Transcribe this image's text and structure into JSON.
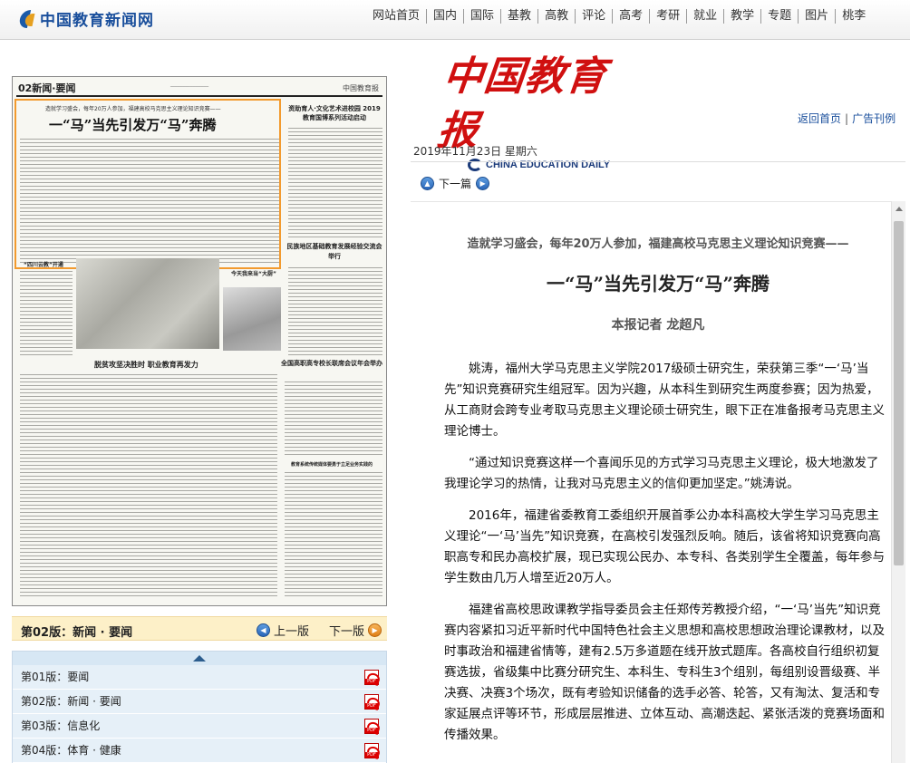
{
  "site": {
    "logo_text": "中国教育新闻网"
  },
  "nav": [
    "网站首页",
    "国内",
    "国际",
    "基教",
    "高教",
    "评论",
    "高考",
    "考研",
    "就业",
    "教学",
    "专题",
    "图片",
    "桃李"
  ],
  "newspaper": {
    "masthead_cn": "中国教育报",
    "masthead_en": "CHINA EDUCATION DAILY",
    "links": {
      "home": "返回首页",
      "ads": "广告刊例"
    },
    "date": "2019年11月23日  星期六",
    "next_article": "下一篇"
  },
  "page_image": {
    "page_label": "02新闻·要闻",
    "masthead": "中国教育报",
    "lead_subtitle": "造就学习盛会，每年20万人参加，福建高校马克思主义理论知识竞赛——",
    "lead_title": "一“马”当先引发万“马”奔腾",
    "right_title": "资助育人·文化艺术进校园 2019教育国博系列活动启动",
    "mid_title": "民族地区基础教育发展经验交流会举行",
    "left_title": "“四川云教”开通",
    "photo_title": "今天我来当“大厨”",
    "section_title": "脱贫攻坚决胜时 职业教育再发力",
    "section_title2": "全国高职高专校长联席会议年会举办",
    "bottom_title": "教育系统传统媒体要勇于立足业务实践的"
  },
  "current_section": {
    "label": "第02版：新闻 · 要闻",
    "prev": "上一版",
    "next": "下一版"
  },
  "page_list": [
    {
      "label": "第01版：要闻",
      "pdf": "PDF"
    },
    {
      "label": "第02版：新闻 · 要闻",
      "pdf": "PDF"
    },
    {
      "label": "第03版：信息化",
      "pdf": "PDF"
    },
    {
      "label": "第04版：体育 · 健康",
      "pdf": "PDF"
    }
  ],
  "article": {
    "subtitle": "造就学习盛会，每年20万人参加，福建高校马克思主义理论知识竞赛——",
    "title": "一“马”当先引发万“马”奔腾",
    "author": "本报记者  龙超凡",
    "paragraphs": [
      "姚涛，福州大学马克思主义学院2017级硕士研究生，荣获第三季“一‘马’当先”知识竞赛研究生组冠军。因为兴趣，从本科生到研究生两度参赛；因为热爱，从工商财会跨专业考取马克思主义理论硕士研究生，眼下正在准备报考马克思主义理论博士。",
      "“通过知识竞赛这样一个喜闻乐见的方式学习马克思主义理论，极大地激发了我理论学习的热情，让我对马克思主义的信仰更加坚定。”姚涛说。",
      "2016年，福建省委教育工委组织开展首季公办本科高校大学生学习马克思主义理论“一‘马’当先”知识竞赛，在高校引发强烈反响。随后，该省将知识竞赛向高职高专和民办高校扩展，现已实现公民办、本专科、各类别学生全覆盖，每年参与学生数由几万人增至近20万人。",
      "福建省高校思政课教学指导委员会主任郑传芳教授介绍，“一‘马’当先”知识竞赛内容紧扣习近平新时代中国特色社会主义思想和高校思想政治理论课教材，以及时事政治和福建省情等，建有2.5万多道题在线开放式题库。各高校自行组织初复赛选拔，省级集中比赛分研究生、本科生、专科生3个组别，每组别设晋级赛、半决赛、决赛3个场次，既有考验知识储备的选手必答、轮答，又有淘汰、复活和专家延展点评等环节，形成层层推进、立体互动、高潮迭起、紧张活泼的竞赛场面和传播效果。"
    ]
  }
}
